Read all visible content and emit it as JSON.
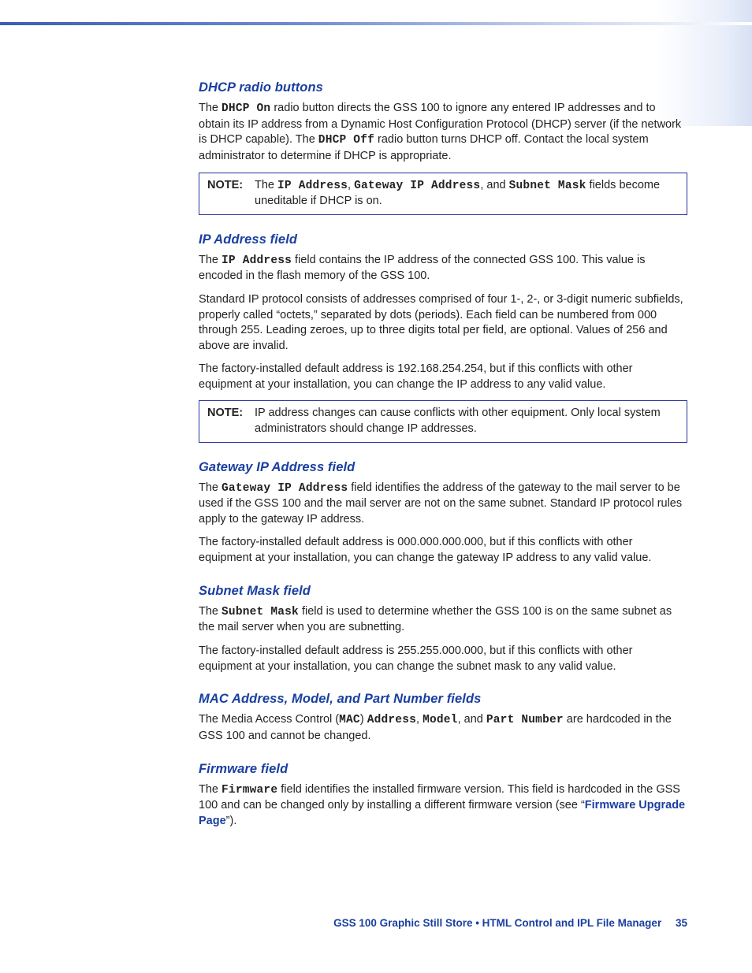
{
  "sections": {
    "dhcp": {
      "heading": "DHCP radio buttons",
      "para1_a": "The ",
      "para1_dhcpon": "DHCP On",
      "para1_b": " radio button directs the GSS 100 to ignore any entered IP addresses and to obtain its IP address from a Dynamic Host Configuration Protocol (DHCP) server (if the network is DHCP capable). The ",
      "para1_dhcpoff": "DHCP Off",
      "para1_c": " radio button turns DHCP off. Contact the local system administrator to determine if DHCP is appropriate.",
      "note_label": "NOTE:",
      "note_a": "The ",
      "note_ip": "IP Address",
      "note_b": ", ",
      "note_gw": "Gateway IP Address",
      "note_c": ", and ",
      "note_sm": "Subnet Mask",
      "note_d": " fields become uneditable if DHCP is on."
    },
    "ip": {
      "heading": "IP Address field",
      "p1_a": "The ",
      "p1_ip": "IP Address",
      "p1_b": " field contains the IP address of the connected GSS 100. This value is encoded in the flash memory of the GSS 100.",
      "p2": "Standard IP protocol consists of addresses comprised of four 1-, 2-, or 3-digit numeric subfields, properly called “octets,” separated by dots (periods). Each field can be numbered from 000 through 255. Leading zeroes, up to three digits total per field, are optional. Values of 256 and above are invalid.",
      "p3": "The factory-installed default address is 192.168.254.254, but if this conflicts with other equipment at your installation, you can change the IP address to any valid value.",
      "note_label": "NOTE:",
      "note_text": "IP address changes can cause conflicts with other equipment. Only local system administrators should change IP addresses."
    },
    "gateway": {
      "heading": "Gateway IP Address field",
      "p1_a": "The ",
      "p1_gw": "Gateway IP Address",
      "p1_b": " field identifies the address of the gateway to the mail server to be used if the GSS 100 and the mail server are not on the same subnet. Standard IP protocol rules apply to the gateway IP address.",
      "p2": "The factory-installed default address is 000.000.000.000, but if this conflicts with other equipment at your installation, you can change the gateway IP address to any valid value."
    },
    "subnet": {
      "heading": "Subnet Mask field",
      "p1_a": "The ",
      "p1_sm": "Subnet Mask",
      "p1_b": " field is used to determine whether the GSS 100 is on the same subnet as the mail server when you are subnetting.",
      "p2": "The factory-installed default address is 255.255.000.000, but if this conflicts with other equipment at your installation, you can change the subnet mask to any valid value."
    },
    "mac": {
      "heading": "MAC Address, Model, and Part Number fields",
      "p1_a": "The Media Access Control (",
      "p1_mac": "MAC",
      "p1_b": ") ",
      "p1_addr": "Address",
      "p1_c": ", ",
      "p1_model": "Model",
      "p1_d": ", and ",
      "p1_part": "Part Number",
      "p1_e": " are hardcoded in the GSS 100 and cannot be changed."
    },
    "firmware": {
      "heading": "Firmware field",
      "p1_a": "The ",
      "p1_fw": "Firmware",
      "p1_b": " field identifies the installed firmware version. This field is hardcoded in the GSS 100 and can be changed only by installing a different firmware version (see “",
      "p1_link": "Firmware Upgrade Page",
      "p1_c": "”)."
    }
  },
  "footer": {
    "text": "GSS 100 Graphic Still Store • HTML Control and IPL File Manager",
    "page": "35"
  }
}
